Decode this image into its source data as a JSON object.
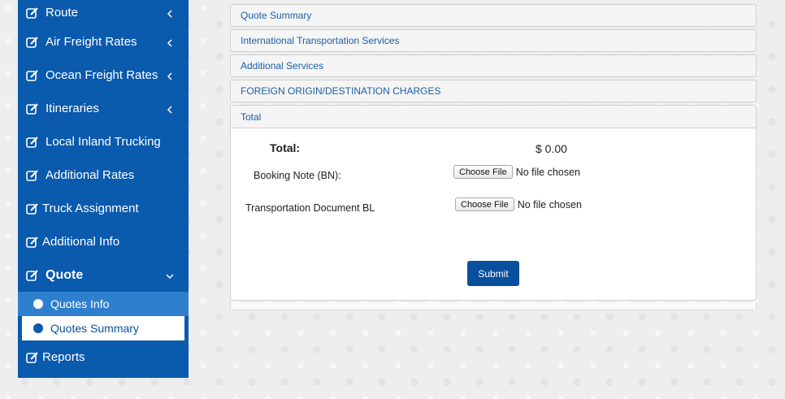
{
  "sidebar": {
    "items": [
      {
        "label": "Route",
        "icon": "edit-icon",
        "chevron": "left"
      },
      {
        "label": "Air Freight Rates",
        "icon": "edit-icon",
        "chevron": "left"
      },
      {
        "label": "Ocean Freight Rates",
        "icon": "edit-icon",
        "chevron": "left"
      },
      {
        "label": "Itineraries",
        "icon": "edit-icon",
        "chevron": "left"
      },
      {
        "label": "Local Inland Trucking",
        "icon": "edit-icon"
      },
      {
        "label": "Additional Rates",
        "icon": "edit-icon"
      },
      {
        "label": "Truck Assignment",
        "icon": "edit-icon"
      },
      {
        "label": "Additional Info",
        "icon": "edit-icon"
      },
      {
        "label": "Quote",
        "icon": "edit-icon",
        "chevron": "down"
      },
      {
        "label": "Reports",
        "icon": "edit-icon"
      }
    ],
    "sub_items": [
      {
        "label": "Quotes Info"
      },
      {
        "label": "Quotes Summary",
        "active": true
      }
    ]
  },
  "main": {
    "panels": [
      {
        "label": "Quote Summary"
      },
      {
        "label": "International Transportation Services"
      },
      {
        "label": "Additional Services"
      },
      {
        "label": "FOREIGN ORIGIN/DESTINATION CHARGES"
      }
    ],
    "total_panel": {
      "title": "Total",
      "total_label": "Total:",
      "total_value": "$ 0.00",
      "booking_note_label": "Booking Note (BN):",
      "transport_doc_label": "Transportation Document BL",
      "choose_file_label": "Choose File",
      "no_file_text": "No file chosen",
      "submit_label": "Submit"
    }
  },
  "colors": {
    "sidebar_bg": "#0a5aad",
    "accent": "#0a4f9c",
    "link": "#1a5ea8"
  }
}
